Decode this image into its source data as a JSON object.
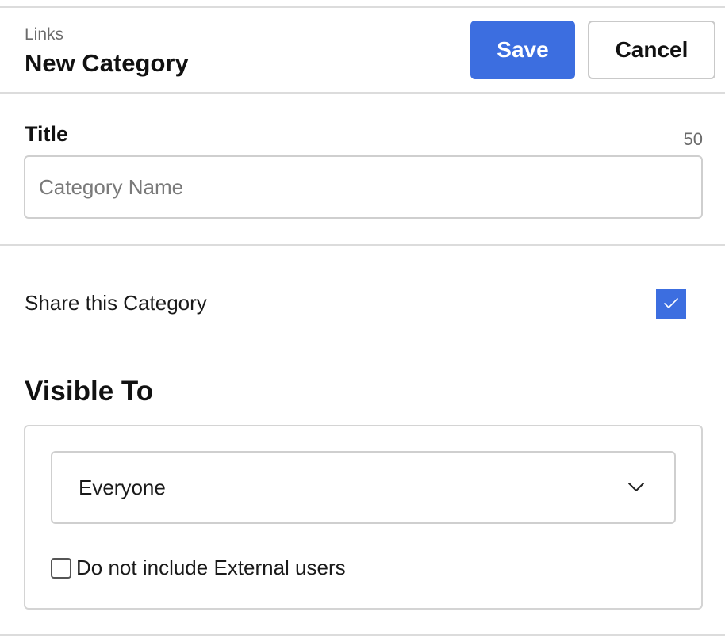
{
  "header": {
    "breadcrumb": "Links",
    "title": "New Category",
    "save_label": "Save",
    "cancel_label": "Cancel"
  },
  "title_field": {
    "label": "Title",
    "char_limit": "50",
    "value": "",
    "placeholder": "Category Name"
  },
  "share": {
    "label": "Share this Category",
    "checked": true,
    "check_icon": "checkmark-icon"
  },
  "visibility": {
    "heading": "Visible To",
    "selected": "Everyone",
    "dropdown_icon": "chevron-down-icon",
    "exclude_external": {
      "label": "Do not include External users",
      "checked": false
    }
  },
  "colors": {
    "accent": "#3c6ee0",
    "border": "#cfcfcf",
    "divider": "#dcdcdc",
    "muted_text": "#6b6b6b"
  }
}
